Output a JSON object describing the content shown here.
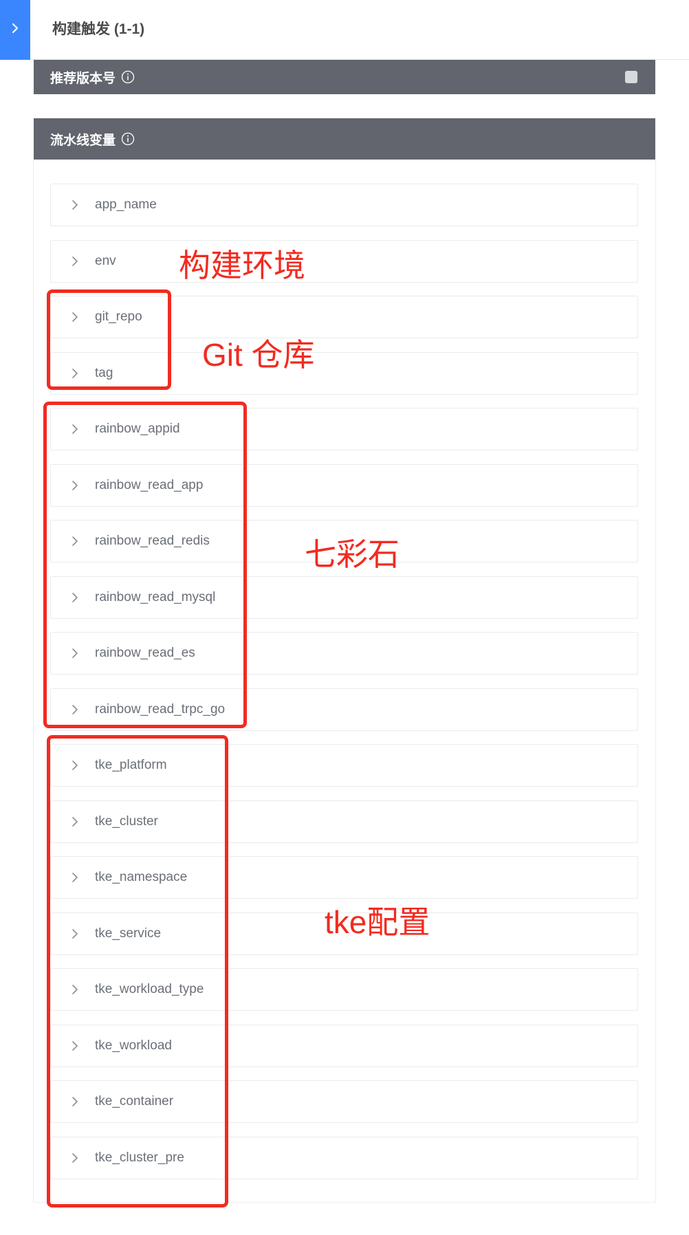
{
  "header": {
    "title": "构建触发 (1-1)",
    "toggle_icon": "chevron-right-icon",
    "accent": "#3a86ff"
  },
  "version_section": {
    "title": "推荐版本号",
    "checked": false
  },
  "vars_section": {
    "title": "流水线变量",
    "items": [
      {
        "name": "app_name"
      },
      {
        "name": "env"
      },
      {
        "name": "git_repo"
      },
      {
        "name": "tag"
      },
      {
        "name": "rainbow_appid"
      },
      {
        "name": "rainbow_read_app"
      },
      {
        "name": "rainbow_read_redis"
      },
      {
        "name": "rainbow_read_mysql"
      },
      {
        "name": "rainbow_read_es"
      },
      {
        "name": "rainbow_read_trpc_go"
      },
      {
        "name": "tke_platform"
      },
      {
        "name": "tke_cluster"
      },
      {
        "name": "tke_namespace"
      },
      {
        "name": "tke_service"
      },
      {
        "name": "tke_workload_type"
      },
      {
        "name": "tke_workload"
      },
      {
        "name": "tke_container"
      },
      {
        "name": "tke_cluster_pre"
      }
    ]
  },
  "annotations": {
    "color": "#f22b20",
    "build_env": "构建环境",
    "git_repo": "Git 仓库",
    "rainbow": "七彩石",
    "tke": "tke配置"
  }
}
